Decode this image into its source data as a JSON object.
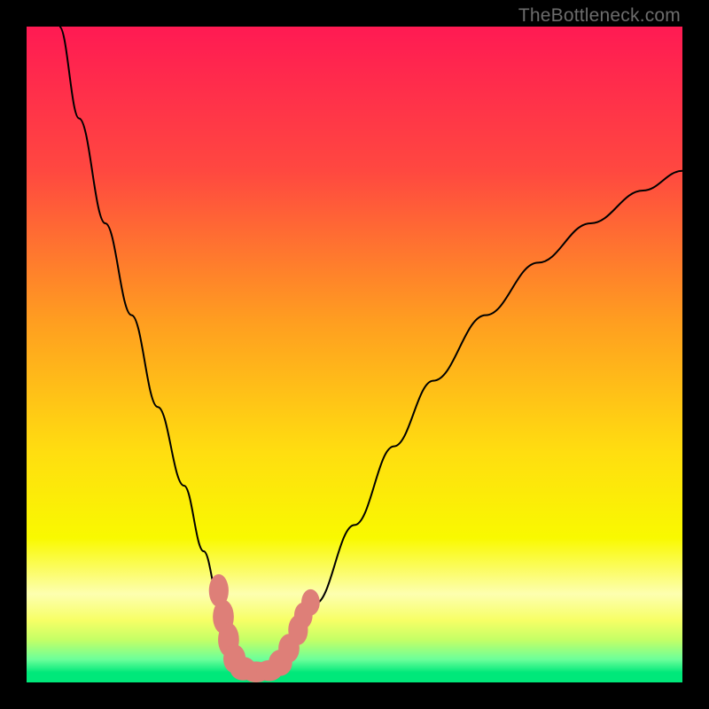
{
  "watermark": "TheBottleneck.com",
  "chart_data": {
    "type": "line",
    "title": "",
    "xlabel": "",
    "ylabel": "",
    "xlim": [
      0,
      100
    ],
    "ylim": [
      0,
      100
    ],
    "grid": false,
    "legend": false,
    "background_gradient": {
      "stops": [
        {
          "offset": 0.0,
          "color": "#ff1a53"
        },
        {
          "offset": 0.22,
          "color": "#ff4840"
        },
        {
          "offset": 0.45,
          "color": "#ff9e20"
        },
        {
          "offset": 0.65,
          "color": "#ffde10"
        },
        {
          "offset": 0.78,
          "color": "#f9f900"
        },
        {
          "offset": 0.865,
          "color": "#fdffb0"
        },
        {
          "offset": 0.905,
          "color": "#f7ff66"
        },
        {
          "offset": 0.935,
          "color": "#c4ff66"
        },
        {
          "offset": 0.965,
          "color": "#6cff9a"
        },
        {
          "offset": 0.985,
          "color": "#00e87a"
        },
        {
          "offset": 1.0,
          "color": "#00e87a"
        }
      ]
    },
    "series": [
      {
        "name": "bottleneck-curve",
        "color": "#000000",
        "x": [
          5,
          8,
          12,
          16,
          20,
          24,
          27,
          29.5,
          31,
          32.5,
          34,
          36,
          38,
          40,
          44,
          50,
          56,
          62,
          70,
          78,
          86,
          94,
          100
        ],
        "y": [
          100,
          86,
          70,
          56,
          42,
          30,
          20,
          12,
          6,
          2.5,
          1.5,
          1.5,
          2.5,
          5,
          12,
          24,
          36,
          46,
          56,
          64,
          70,
          75,
          78
        ]
      }
    ],
    "markers": {
      "name": "highlight-beads",
      "color": "#de7f78",
      "points": [
        {
          "x": 29.3,
          "y": 14.0,
          "rx": 1.5,
          "ry": 2.5
        },
        {
          "x": 30.0,
          "y": 10.0,
          "rx": 1.6,
          "ry": 2.6
        },
        {
          "x": 30.8,
          "y": 6.5,
          "rx": 1.6,
          "ry": 2.6
        },
        {
          "x": 31.7,
          "y": 3.6,
          "rx": 1.7,
          "ry": 2.2
        },
        {
          "x": 33.0,
          "y": 2.1,
          "rx": 2.0,
          "ry": 1.8
        },
        {
          "x": 35.0,
          "y": 1.6,
          "rx": 2.2,
          "ry": 1.6
        },
        {
          "x": 37.0,
          "y": 1.8,
          "rx": 2.0,
          "ry": 1.6
        },
        {
          "x": 38.7,
          "y": 3.0,
          "rx": 1.8,
          "ry": 2.0
        },
        {
          "x": 40.0,
          "y": 5.2,
          "rx": 1.6,
          "ry": 2.2
        },
        {
          "x": 41.4,
          "y": 8.0,
          "rx": 1.5,
          "ry": 2.3
        },
        {
          "x": 42.2,
          "y": 10.2,
          "rx": 1.4,
          "ry": 2.0
        },
        {
          "x": 43.3,
          "y": 12.2,
          "rx": 1.4,
          "ry": 2.0
        }
      ]
    }
  }
}
